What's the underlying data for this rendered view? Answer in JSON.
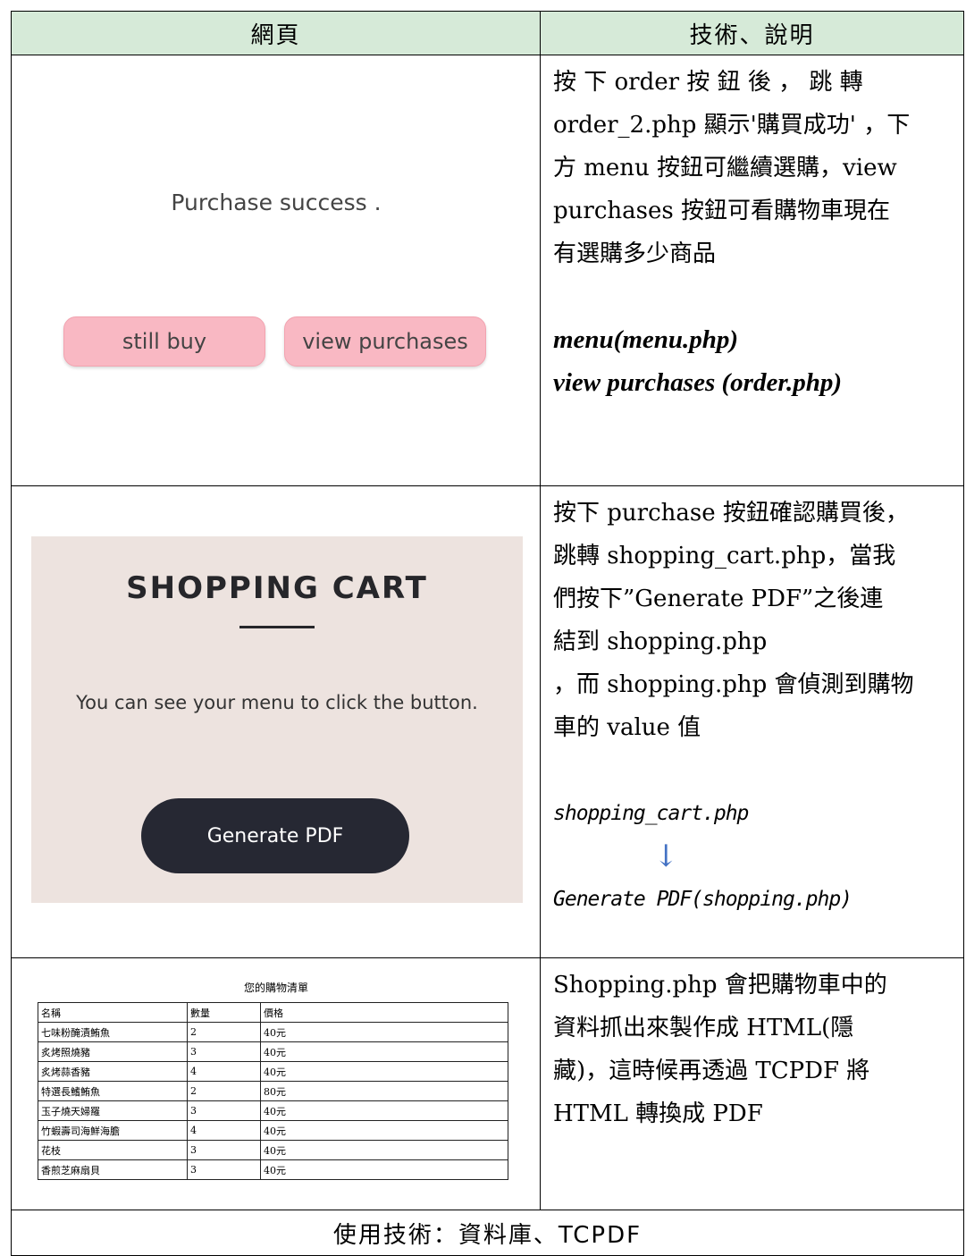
{
  "header": {
    "col1": "網頁",
    "col2": "技術、說明"
  },
  "row1": {
    "screenshot": {
      "message": "Purchase success .",
      "btn_still_buy": "still buy",
      "btn_view_purchases": "view purchases"
    },
    "desc_lines": [
      "按 下 order 按 鈕 後 ， 跳 轉",
      "order_2.php 顯示'購買成功' ，下",
      "方 menu 按鈕可繼續選購，view",
      "purchases 按鈕可看購物車現在",
      "有選購多少商品"
    ],
    "link_menu": "menu(menu.php)",
    "link_view": "view purchases (order.php)"
  },
  "row2": {
    "screenshot": {
      "title": "SHOPPING CART",
      "subtitle": "You can see your menu to click the button.",
      "button": "Generate PDF"
    },
    "desc_lines": [
      "按下 purchase 按鈕確認購買後，",
      "跳轉 shopping_cart.php，當我",
      "們按下”Generate PDF”之後連",
      "結到 shopping.php",
      "，而 shopping.php 會偵測到購物",
      "車的 value 值"
    ],
    "flow_from": "shopping_cart.php",
    "flow_arrow": "↓",
    "flow_to": "Generate PDF(shopping.php)"
  },
  "row3": {
    "screenshot": {
      "caption": "您的購物清單",
      "columns": [
        "名稱",
        "數量",
        "價格"
      ],
      "rows": [
        [
          "七味粉醃漬鮪魚",
          "2",
          "40元"
        ],
        [
          "炙烤照燒豬",
          "3",
          "40元"
        ],
        [
          "炙烤蒜香豬",
          "4",
          "40元"
        ],
        [
          "特選長鰭鮪魚",
          "2",
          "80元"
        ],
        [
          "玉子燒天婦羅",
          "3",
          "40元"
        ],
        [
          "竹蝦壽司海鮮海膽",
          "4",
          "40元"
        ],
        [
          "花枝",
          "3",
          "40元"
        ],
        [
          "香煎芝麻扇貝",
          "3",
          "40元"
        ]
      ]
    },
    "desc_lines": [
      "Shopping.php 會把購物車中的",
      "資料抓出來製作成 HTML(隱",
      "藏)，這時候再透過 TCPDF 將",
      "HTML 轉換成 PDF"
    ]
  },
  "footer": "使用技術：資料庫、TCPDF",
  "colors": {
    "header_bg": "#d6ead8",
    "pill": "#f9b8c3",
    "cart_bg": "#ede3df",
    "dark_button": "#262833",
    "arrow": "#4472c4"
  }
}
